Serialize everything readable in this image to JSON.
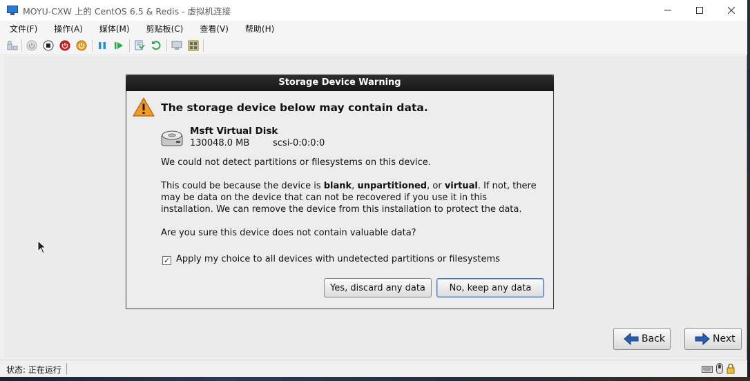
{
  "window": {
    "title": "MOYU-CXW 上的 CentOS 6.5 & Redis - 虚拟机连接",
    "minimize": "—",
    "maximize": "☐",
    "close": "✕"
  },
  "menu": [
    {
      "label": "文件(F)"
    },
    {
      "label": "操作(A)"
    },
    {
      "label": "媒体(M)"
    },
    {
      "label": "剪贴板(C)"
    },
    {
      "label": "查看(V)"
    },
    {
      "label": "帮助(H)"
    }
  ],
  "toolbar": {
    "icons": [
      "ctrl-alt-del-icon",
      "start-icon",
      "turn-off-icon",
      "shut-down-icon",
      "save-icon",
      "pause-icon",
      "resume-icon",
      "checkpoint-icon",
      "revert-icon",
      "enhanced-session-icon",
      "share-icon"
    ]
  },
  "dialog": {
    "title": "Storage Device Warning",
    "heading": "The storage device below may contain data.",
    "disk": {
      "name": "Msft Virtual Disk",
      "size": "130048.0 MB",
      "id": "scsi-0:0:0:0"
    },
    "message1": "We could not detect partitions or filesystems on this device.",
    "message2": {
      "pre": "This could be because the device is ",
      "blank": "blank",
      "sep1": ", ",
      "unpartitioned": "unpartitioned",
      "sep2": ", or ",
      "virtual": "virtual",
      "post": ". If not, there",
      "line2": "may be data on the device that can not be recovered if you use it in this",
      "line3": "installation. We can remove the device from this installation to protect the data."
    },
    "question": "Are you sure this device does not contain valuable data?",
    "checkbox": {
      "checked": true,
      "mark": "✓",
      "label": "Apply my choice to all devices with undetected partitions or filesystems"
    },
    "discard_button": "Yes, discard any data",
    "keep_button": "No, keep any data"
  },
  "nav": {
    "back": "Back",
    "next": "Next"
  },
  "status": {
    "text": "状态: 正在运行"
  },
  "colors": {
    "dialog_title_bg": "#1f1f1f",
    "warning": "#e8801a",
    "nav_arrow": "#2a5fb0",
    "guest_bg": "#ebebeb"
  }
}
